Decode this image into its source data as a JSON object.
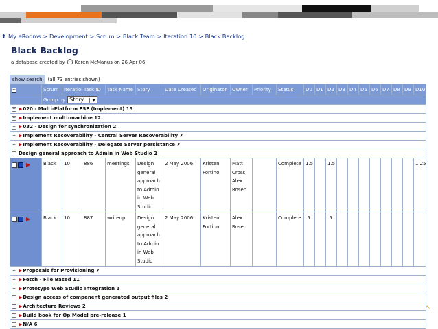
{
  "breadcrumb": "My eRooms > Development > Scrum > Black Team > Iteration 10 > Black Backlog",
  "title": "Black Backlog",
  "subtitle_prefix": "a database created by",
  "subtitle_suffix": "Karen McManus on 26 Apr 06",
  "search_button": "show search",
  "entries_shown": "(all 73 entries shown)",
  "columns": [
    "Scrum",
    "Iteration",
    "Task ID",
    "Task Name",
    "Story",
    "Date Created",
    "Originator",
    "Owner",
    "Priority",
    "Status",
    "D0",
    "D1",
    "D2",
    "D3",
    "D4",
    "D5",
    "D6",
    "D7",
    "D8",
    "D9",
    "D10"
  ],
  "group_by_label": "Group by",
  "group_by_value": "Story",
  "groups_before": [
    "020 - Multi-Platform ESF (Implement) 13",
    "Implement multi-machine 12",
    "032 - Design for synchronization 2",
    "Implement Recoverability - Central Server Recoverability 7",
    "Implement Recoverability - Delegate Server persistance 7"
  ],
  "open_group": "Design general approach to Admin in Web Studio 2",
  "rows": [
    {
      "scrum": "Black",
      "iteration": "10",
      "task_id": "886",
      "task_name": "meetings",
      "story": "Design general approach to Admin in Web Studio",
      "date": "2 May 2006",
      "originator": "Kristen Fortino",
      "owner": "Matt Cross, Alex Rosen",
      "priority": "",
      "status": "Complete",
      "d0": "1.5",
      "d1": "",
      "d2": "1.5",
      "d10": "1.25"
    },
    {
      "scrum": "Black",
      "iteration": "10",
      "task_id": "887",
      "task_name": "writeup",
      "story": "Design general approach to Admin in Web Studio",
      "date": "2 May 2006",
      "originator": "Kristen Fortino",
      "owner": "Alex Rosen",
      "priority": "",
      "status": "Complete",
      "d0": ".5",
      "d1": "",
      "d2": ".5",
      "d10": ""
    }
  ],
  "groups_after": [
    "Proposals for Provisioning 7",
    "Fetch - File Based 11",
    "Prototype Web Studio Integration 1",
    "Design access of compenent generated output files 2",
    "Architecture Reviews 2",
    "Build book for Op Model pre-release 1",
    "N/A 6"
  ],
  "colors": {
    "header": "#7b9ad6",
    "link": "#1a3a8f",
    "triangle": "#b01515"
  }
}
